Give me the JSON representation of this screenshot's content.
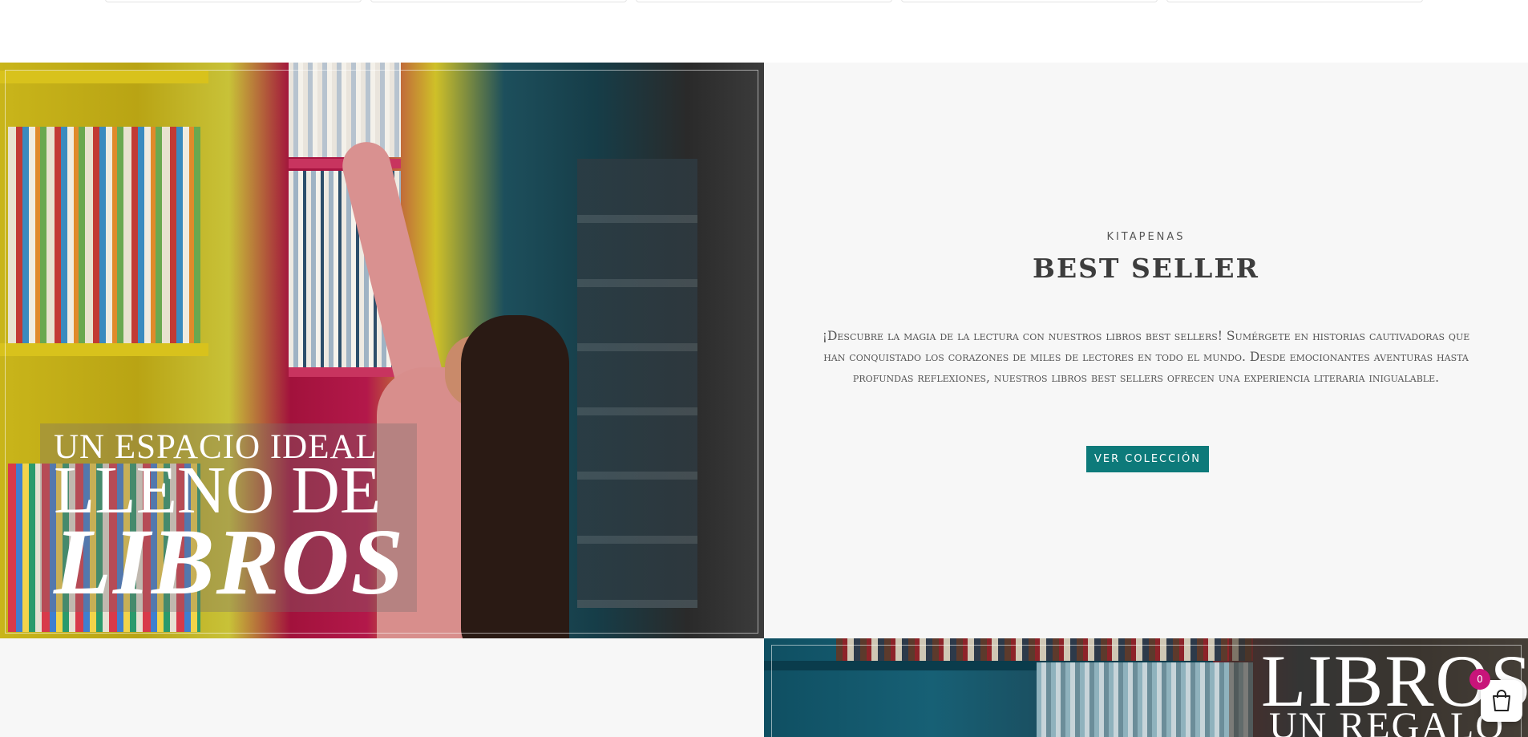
{
  "hero_left": {
    "line1": "UN ESPACIO IDEAL",
    "line2": "LLENO DE",
    "line3": "LIBROS"
  },
  "promo": {
    "eyebrow": "KITAPENAS",
    "headline": "BEST SELLER",
    "description": "¡Descubre la magia de la lectura con nuestros libros best sellers! Sumérgete en historias cautivadoras que han conquistado los corazones de miles de lectores en todo el mundo. Desde emocionantes aventuras hasta profundas reflexiones, nuestros libros best sellers ofrecen una experiencia literaria inigualable.",
    "cta_label": "VER COLECCIÓN",
    "cta_color": "#0d7a7a"
  },
  "hero_bottom": {
    "line1": "LIBROS",
    "line2": "UN REGALO"
  },
  "cart": {
    "count": "0",
    "icon": "shopping-bag-icon",
    "badge_color": "#c8147a"
  }
}
